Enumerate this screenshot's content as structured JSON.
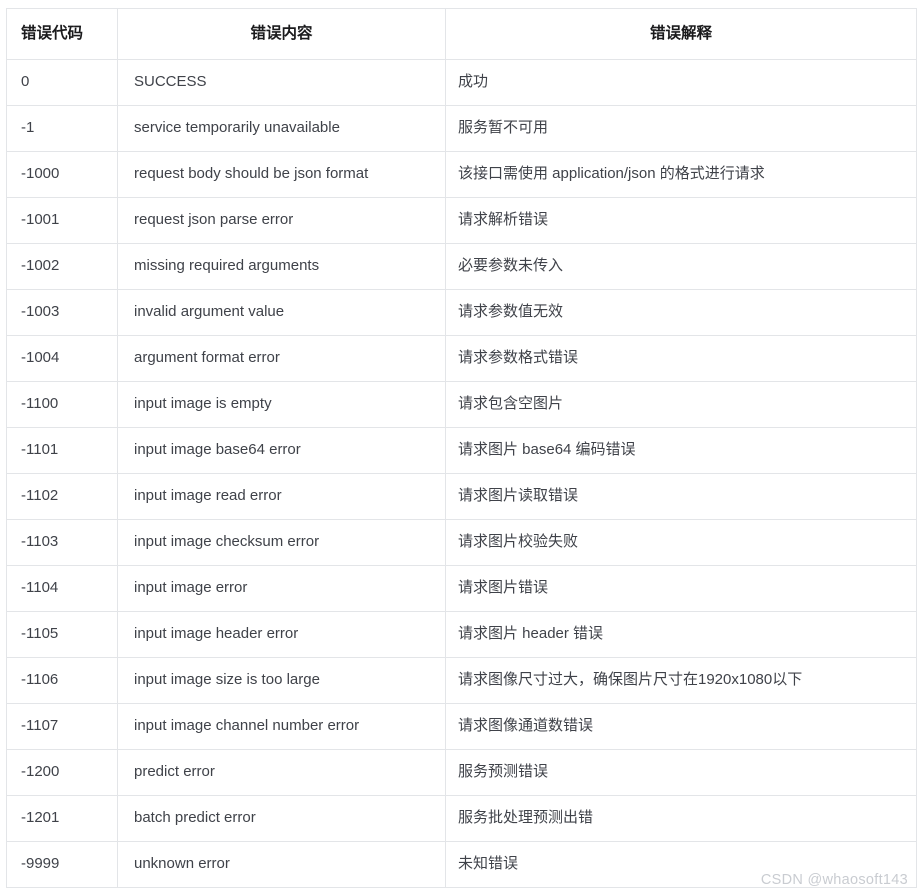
{
  "table": {
    "headers": {
      "code": "错误代码",
      "message": "错误内容",
      "detail": "错误解释"
    },
    "rows": [
      {
        "code": "0",
        "message": "SUCCESS",
        "detail": "成功"
      },
      {
        "code": "-1",
        "message": "service temporarily unavailable",
        "detail": "服务暂不可用"
      },
      {
        "code": "-1000",
        "message": "request body should be json format",
        "detail": "该接口需使用 application/json 的格式进行请求"
      },
      {
        "code": "-1001",
        "message": "request json parse error",
        "detail": "请求解析错误"
      },
      {
        "code": "-1002",
        "message": "missing required arguments",
        "detail": "必要参数未传入"
      },
      {
        "code": "-1003",
        "message": "invalid argument value",
        "detail": "请求参数值无效"
      },
      {
        "code": "-1004",
        "message": "argument format error",
        "detail": "请求参数格式错误"
      },
      {
        "code": "-1100",
        "message": "input image is empty",
        "detail": "请求包含空图片"
      },
      {
        "code": "-1101",
        "message": "input image base64 error",
        "detail": "请求图片 base64 编码错误"
      },
      {
        "code": "-1102",
        "message": "input image read error",
        "detail": "请求图片读取错误"
      },
      {
        "code": "-1103",
        "message": "input image checksum error",
        "detail": "请求图片校验失败"
      },
      {
        "code": "-1104",
        "message": "input image error",
        "detail": "请求图片错误"
      },
      {
        "code": "-1105",
        "message": "input image header error",
        "detail": "请求图片 header 错误"
      },
      {
        "code": "-1106",
        "message": "input image size is too large",
        "detail": "请求图像尺寸过大，确保图片尺寸在1920x1080以下"
      },
      {
        "code": "-1107",
        "message": "input image channel number error",
        "detail": "请求图像通道数错误"
      },
      {
        "code": "-1200",
        "message": "predict error",
        "detail": "服务预测错误"
      },
      {
        "code": "-1201",
        "message": "batch predict error",
        "detail": "服务批处理预测出错"
      },
      {
        "code": "-9999",
        "message": "unknown error",
        "detail": "未知错误"
      }
    ]
  },
  "watermark": {
    "text": "CSDN @whaosoft143"
  },
  "colors": {
    "border": "#e3e5e8",
    "body_text": "#3f4249",
    "header_text": "#1b1b1d",
    "watermark_text": "#c9ccd1",
    "background": "#ffffff"
  }
}
